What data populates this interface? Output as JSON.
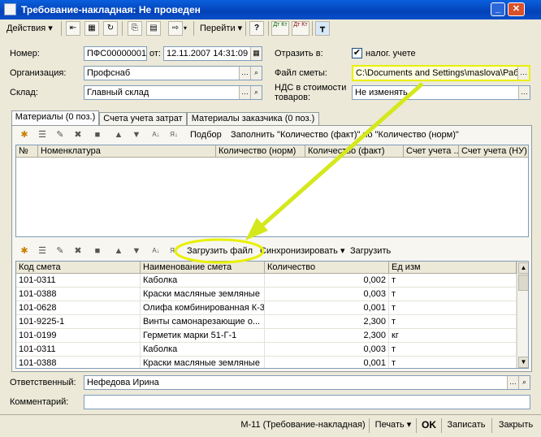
{
  "window": {
    "title": "Требование-накладная: Не проведен",
    "minimize": "_",
    "close": "✕"
  },
  "toolbar": {
    "actions": "Действия",
    "goto": "Перейти",
    "help": "?",
    "dt_kt_1": "Дт Кт",
    "dt_kt_2": "Дт Кт"
  },
  "header": {
    "number_label": "Номер:",
    "number_value": "ПФС00000001",
    "date_label": "от:",
    "date_value": "12.11.2007 14:31:09",
    "reflect_label": "Отразить в:",
    "tax_check_label": "налог. учете",
    "tax_checked": "✔",
    "org_label": "Организация:",
    "org_value": "Профснаб",
    "estimate_file_label": "Файл сметы:",
    "estimate_file_value": "C:\\Documents and Settings\\maslova\\Раб",
    "warehouse_label": "Склад:",
    "warehouse_value": "Главный склад",
    "vat_label": "НДС в стоимости товаров:",
    "vat_value": "Не изменять"
  },
  "tabs": [
    {
      "label": "Материалы (0 поз.)"
    },
    {
      "label": "Счета учета затрат"
    },
    {
      "label": "Материалы заказчика (0 поз.)"
    }
  ],
  "materials_toolbar": {
    "pick": "Подбор",
    "fill": "Заполнить \"Количество (факт)\" по \"Количество (норм)\""
  },
  "materials_columns": [
    "№",
    "Номенклатура",
    "Количество (норм)",
    "Количество (факт)",
    "Счет учета ...",
    "Счет учета (НУ)"
  ],
  "estimate_toolbar": {
    "load_file": "Загрузить файл",
    "sync": "Синхронизировать",
    "load": "Загрузить"
  },
  "estimate_columns": [
    "Код смета",
    "Наименование смета",
    "Количество",
    "Ед изм"
  ],
  "estimate_rows": [
    {
      "code": "101-0311",
      "name": "Каболка",
      "qty": "0,002",
      "unit": "т"
    },
    {
      "code": "101-0388",
      "name": "Краски масляные земляные",
      "qty": "0,003",
      "unit": "т"
    },
    {
      "code": "101-0628",
      "name": "Олифа комбинированная К-3",
      "qty": "0,001",
      "unit": "т"
    },
    {
      "code": "101-9225-1",
      "name": "Винты самонарезающие о...",
      "qty": "2,300",
      "unit": "т"
    },
    {
      "code": "101-0199",
      "name": "Герметик марки 51-Г-1",
      "qty": "2,300",
      "unit": "кг"
    },
    {
      "code": "101-0311",
      "name": "Каболка",
      "qty": "0,003",
      "unit": "т"
    },
    {
      "code": "101-0388",
      "name": "Краски масляные земляные",
      "qty": "0,001",
      "unit": "т"
    }
  ],
  "footer": {
    "responsible_label": "Ответственный:",
    "responsible_value": "Нефедова Ирина",
    "comment_label": "Комментарий:",
    "comment_value": ""
  },
  "status": {
    "form": "М-11 (Требование-накладная)",
    "print": "Печать",
    "ok": "OK",
    "write": "Записать",
    "close": "Закрыть"
  },
  "colors": {
    "highlight": "#E8F000",
    "arrow": "#D4E81C",
    "title_bar": "#0A5FDD"
  }
}
